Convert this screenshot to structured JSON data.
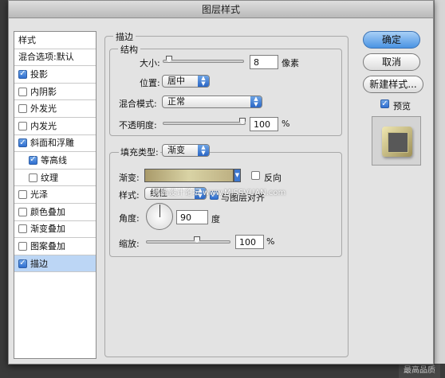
{
  "window": {
    "title": "图层样式"
  },
  "style_list": [
    {
      "label": "样式",
      "type": "header"
    },
    {
      "label": "混合选项:默认",
      "type": "header"
    },
    {
      "label": "投影",
      "checked": true
    },
    {
      "label": "内阴影",
      "checked": false
    },
    {
      "label": "外发光",
      "checked": false
    },
    {
      "label": "内发光",
      "checked": false
    },
    {
      "label": "斜面和浮雕",
      "checked": true
    },
    {
      "label": "等高线",
      "checked": true,
      "indent": true
    },
    {
      "label": "纹理",
      "checked": false,
      "indent": true
    },
    {
      "label": "光泽",
      "checked": false
    },
    {
      "label": "颜色叠加",
      "checked": false
    },
    {
      "label": "渐变叠加",
      "checked": false
    },
    {
      "label": "图案叠加",
      "checked": false
    },
    {
      "label": "描边",
      "checked": true,
      "selected": true
    }
  ],
  "stroke": {
    "title": "描边",
    "structure": {
      "title": "结构",
      "size_label": "大小:",
      "size_value": "8",
      "size_unit": "像素",
      "position_label": "位置:",
      "position_value": "居中",
      "blend_mode_label": "混合模式:",
      "blend_mode_value": "正常",
      "opacity_label": "不透明度:",
      "opacity_value": "100",
      "opacity_unit": "%"
    },
    "fill": {
      "fill_type_label": "填充类型:",
      "fill_type_value": "渐变",
      "gradient_label": "渐变:",
      "reverse_label": "反向",
      "reverse_checked": false,
      "style_label": "样式:",
      "style_value": "线性",
      "align_label": "与图层对齐",
      "align_checked": true,
      "angle_label": "角度:",
      "angle_value": "90",
      "angle_unit": "度",
      "scale_label": "缩放:",
      "scale_value": "100",
      "scale_unit": "%"
    }
  },
  "buttons": {
    "ok": "确定",
    "cancel": "取消",
    "new_style": "新建样式...",
    "preview_label": "预览",
    "preview_checked": true
  },
  "watermark": "思缘设计论坛 www.MISSVUAN.com",
  "status_text": "最高品质",
  "colors": {
    "accent": "#4a93e3",
    "selected_row": "#bcd6f5",
    "gradient_start": "#a99a6a",
    "gradient_mid": "#d9d3a5",
    "gradient_end": "#bdb082"
  }
}
